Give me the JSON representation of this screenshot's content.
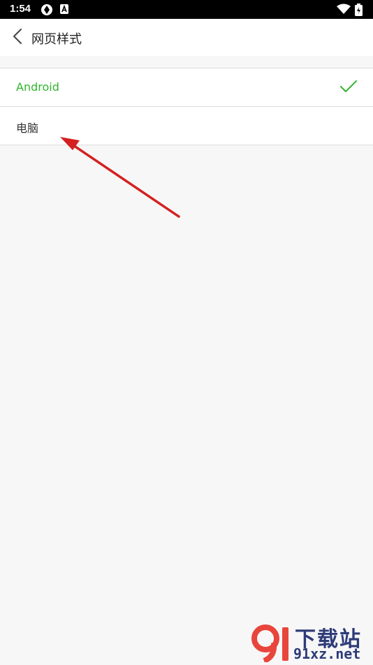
{
  "status_bar": {
    "time": "1:54",
    "icons": [
      "settings-aperture-icon",
      "app-a-icon",
      "wifi-icon",
      "battery-icon"
    ]
  },
  "header": {
    "back_icon": "chevron-left-icon",
    "title": "网页样式"
  },
  "options": [
    {
      "label": "Android",
      "selected": true
    },
    {
      "label": "电脑",
      "selected": false
    }
  ],
  "colors": {
    "accent": "#2fb52c",
    "annotation_arrow": "#d42020",
    "background": "#f7f7f7"
  },
  "watermark": {
    "logo_text": "91",
    "top_text": "下载站",
    "bottom_text": "91xz.net"
  }
}
